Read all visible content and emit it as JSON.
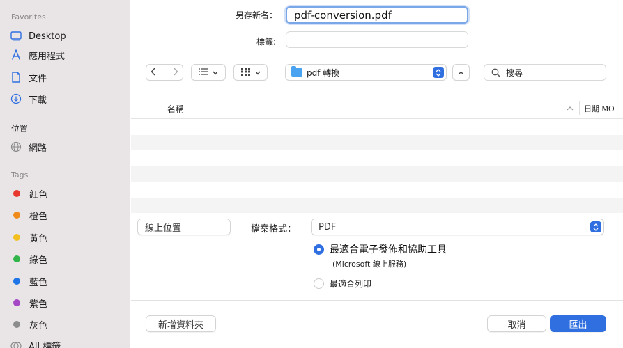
{
  "sidebar": {
    "favorites_title": "Favorites",
    "favorites": [
      {
        "label": "Desktop",
        "icon": "desktop-icon"
      },
      {
        "label": "應用程式",
        "icon": "applications-icon"
      },
      {
        "label": "文件",
        "icon": "document-icon"
      },
      {
        "label": "下載",
        "icon": "download-icon"
      }
    ],
    "locations_title": "位置",
    "locations": [
      {
        "label": "網路",
        "icon": "network-icon"
      }
    ],
    "tags_title": "Tags",
    "tags": [
      {
        "label": "紅色",
        "color": "#e8392f"
      },
      {
        "label": "橙色",
        "color": "#ef8a1b"
      },
      {
        "label": "黃色",
        "color": "#f2bf1e"
      },
      {
        "label": "綠色",
        "color": "#31b44a"
      },
      {
        "label": "藍色",
        "color": "#1f75e8"
      },
      {
        "label": "紫色",
        "color": "#a548c6"
      },
      {
        "label": "灰色",
        "color": "#8c8c8c"
      }
    ],
    "all_tags": "All 標籤"
  },
  "form": {
    "save_as_label": "另存新名：",
    "filename": "pdf-conversion.pdf",
    "tags_label": "標籤:",
    "tags_value": ""
  },
  "toolbar": {
    "location": "pdf 轉換",
    "search_placeholder": "搜尋"
  },
  "list": {
    "col_name": "名稱",
    "col_date": "日期 MO"
  },
  "options": {
    "online_location": "線上位置",
    "format_label": "檔案格式：",
    "format_value": "PDF",
    "radio1_label": "最適合電子發佈和協助工具",
    "radio1_sub": "(Microsoft 線上服務)",
    "radio2_label": "最適合列印"
  },
  "footer": {
    "new_folder": "新增資料夾",
    "cancel": "取消",
    "export": "匯出"
  },
  "colors": {
    "accent": "#2f6fe0",
    "sidebar_bg": "#e9e5e6"
  }
}
